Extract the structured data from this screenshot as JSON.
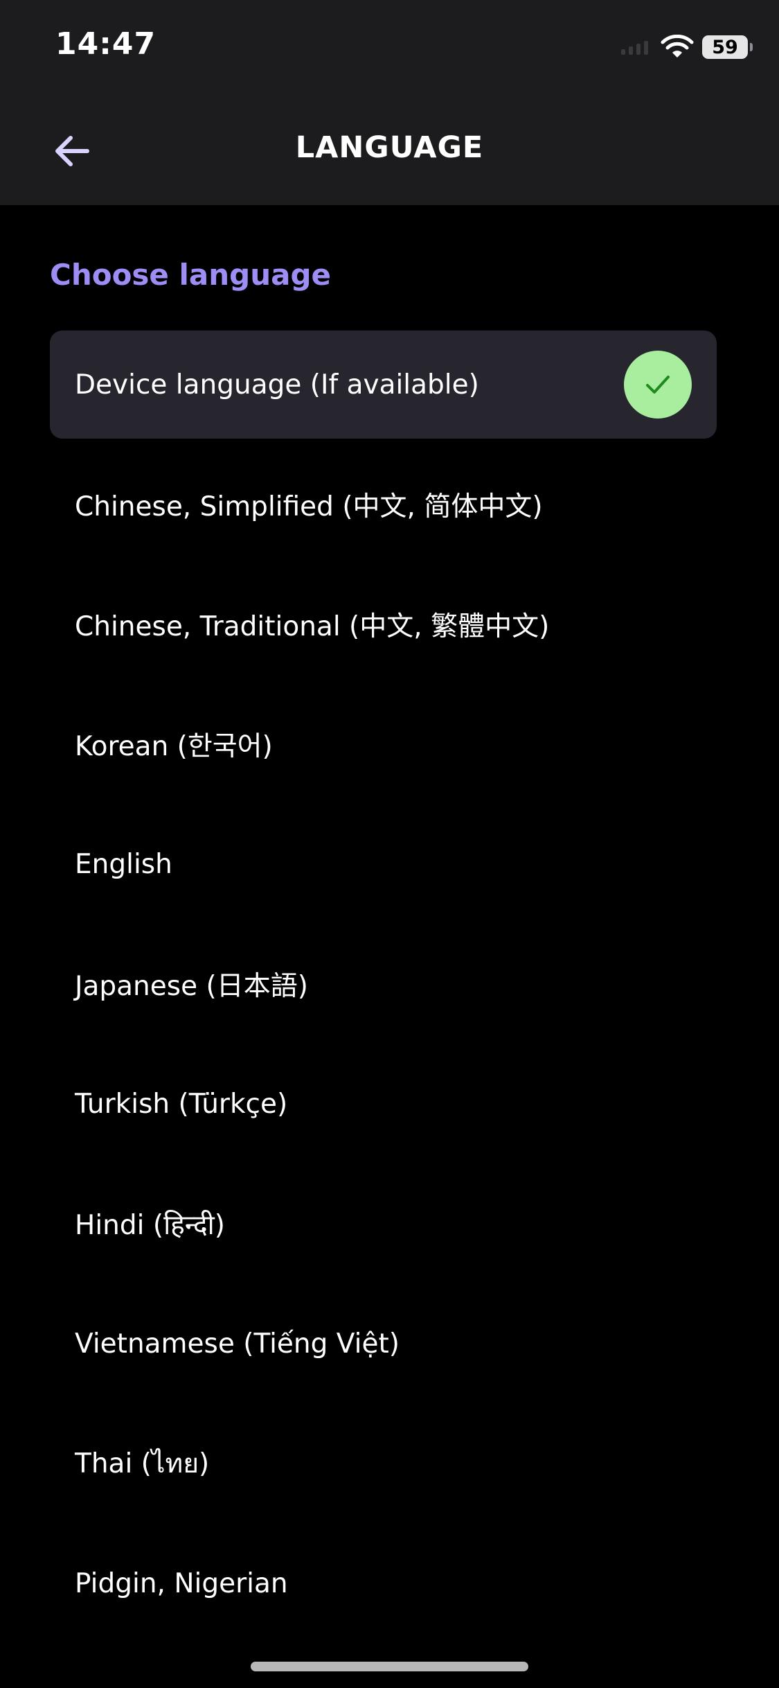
{
  "status_bar": {
    "time": "14:47",
    "battery_level": "59",
    "icons": [
      "signal-icon",
      "wifi-icon",
      "battery-icon"
    ]
  },
  "header": {
    "title": "LANGUAGE",
    "back_icon": "arrow-left-icon"
  },
  "section": {
    "title": "Choose language"
  },
  "languages": [
    {
      "label": "Device language (If available)",
      "selected": true
    },
    {
      "label": "Chinese, Simplified (中文, 简体中文)",
      "selected": false
    },
    {
      "label": "Chinese, Traditional (中文, 繁體中文)",
      "selected": false
    },
    {
      "label": "Korean (한국어)",
      "selected": false
    },
    {
      "label": "English",
      "selected": false
    },
    {
      "label": "Japanese (日本語)",
      "selected": false
    },
    {
      "label": "Turkish (Türkçe)",
      "selected": false
    },
    {
      "label": "Hindi (हिन्दी)",
      "selected": false
    },
    {
      "label": "Vietnamese (Tiếng Việt)",
      "selected": false
    },
    {
      "label": "Thai (ไทย)",
      "selected": false
    },
    {
      "label": "Pidgin, Nigerian",
      "selected": false
    }
  ],
  "colors": {
    "accent": "#9d8ef5",
    "selected_bg": "#27262e",
    "check_bg": "#a8ee9e",
    "check_mark": "#1f8a1f",
    "header_bg": "#1c1c1e",
    "page_bg": "#000000"
  }
}
